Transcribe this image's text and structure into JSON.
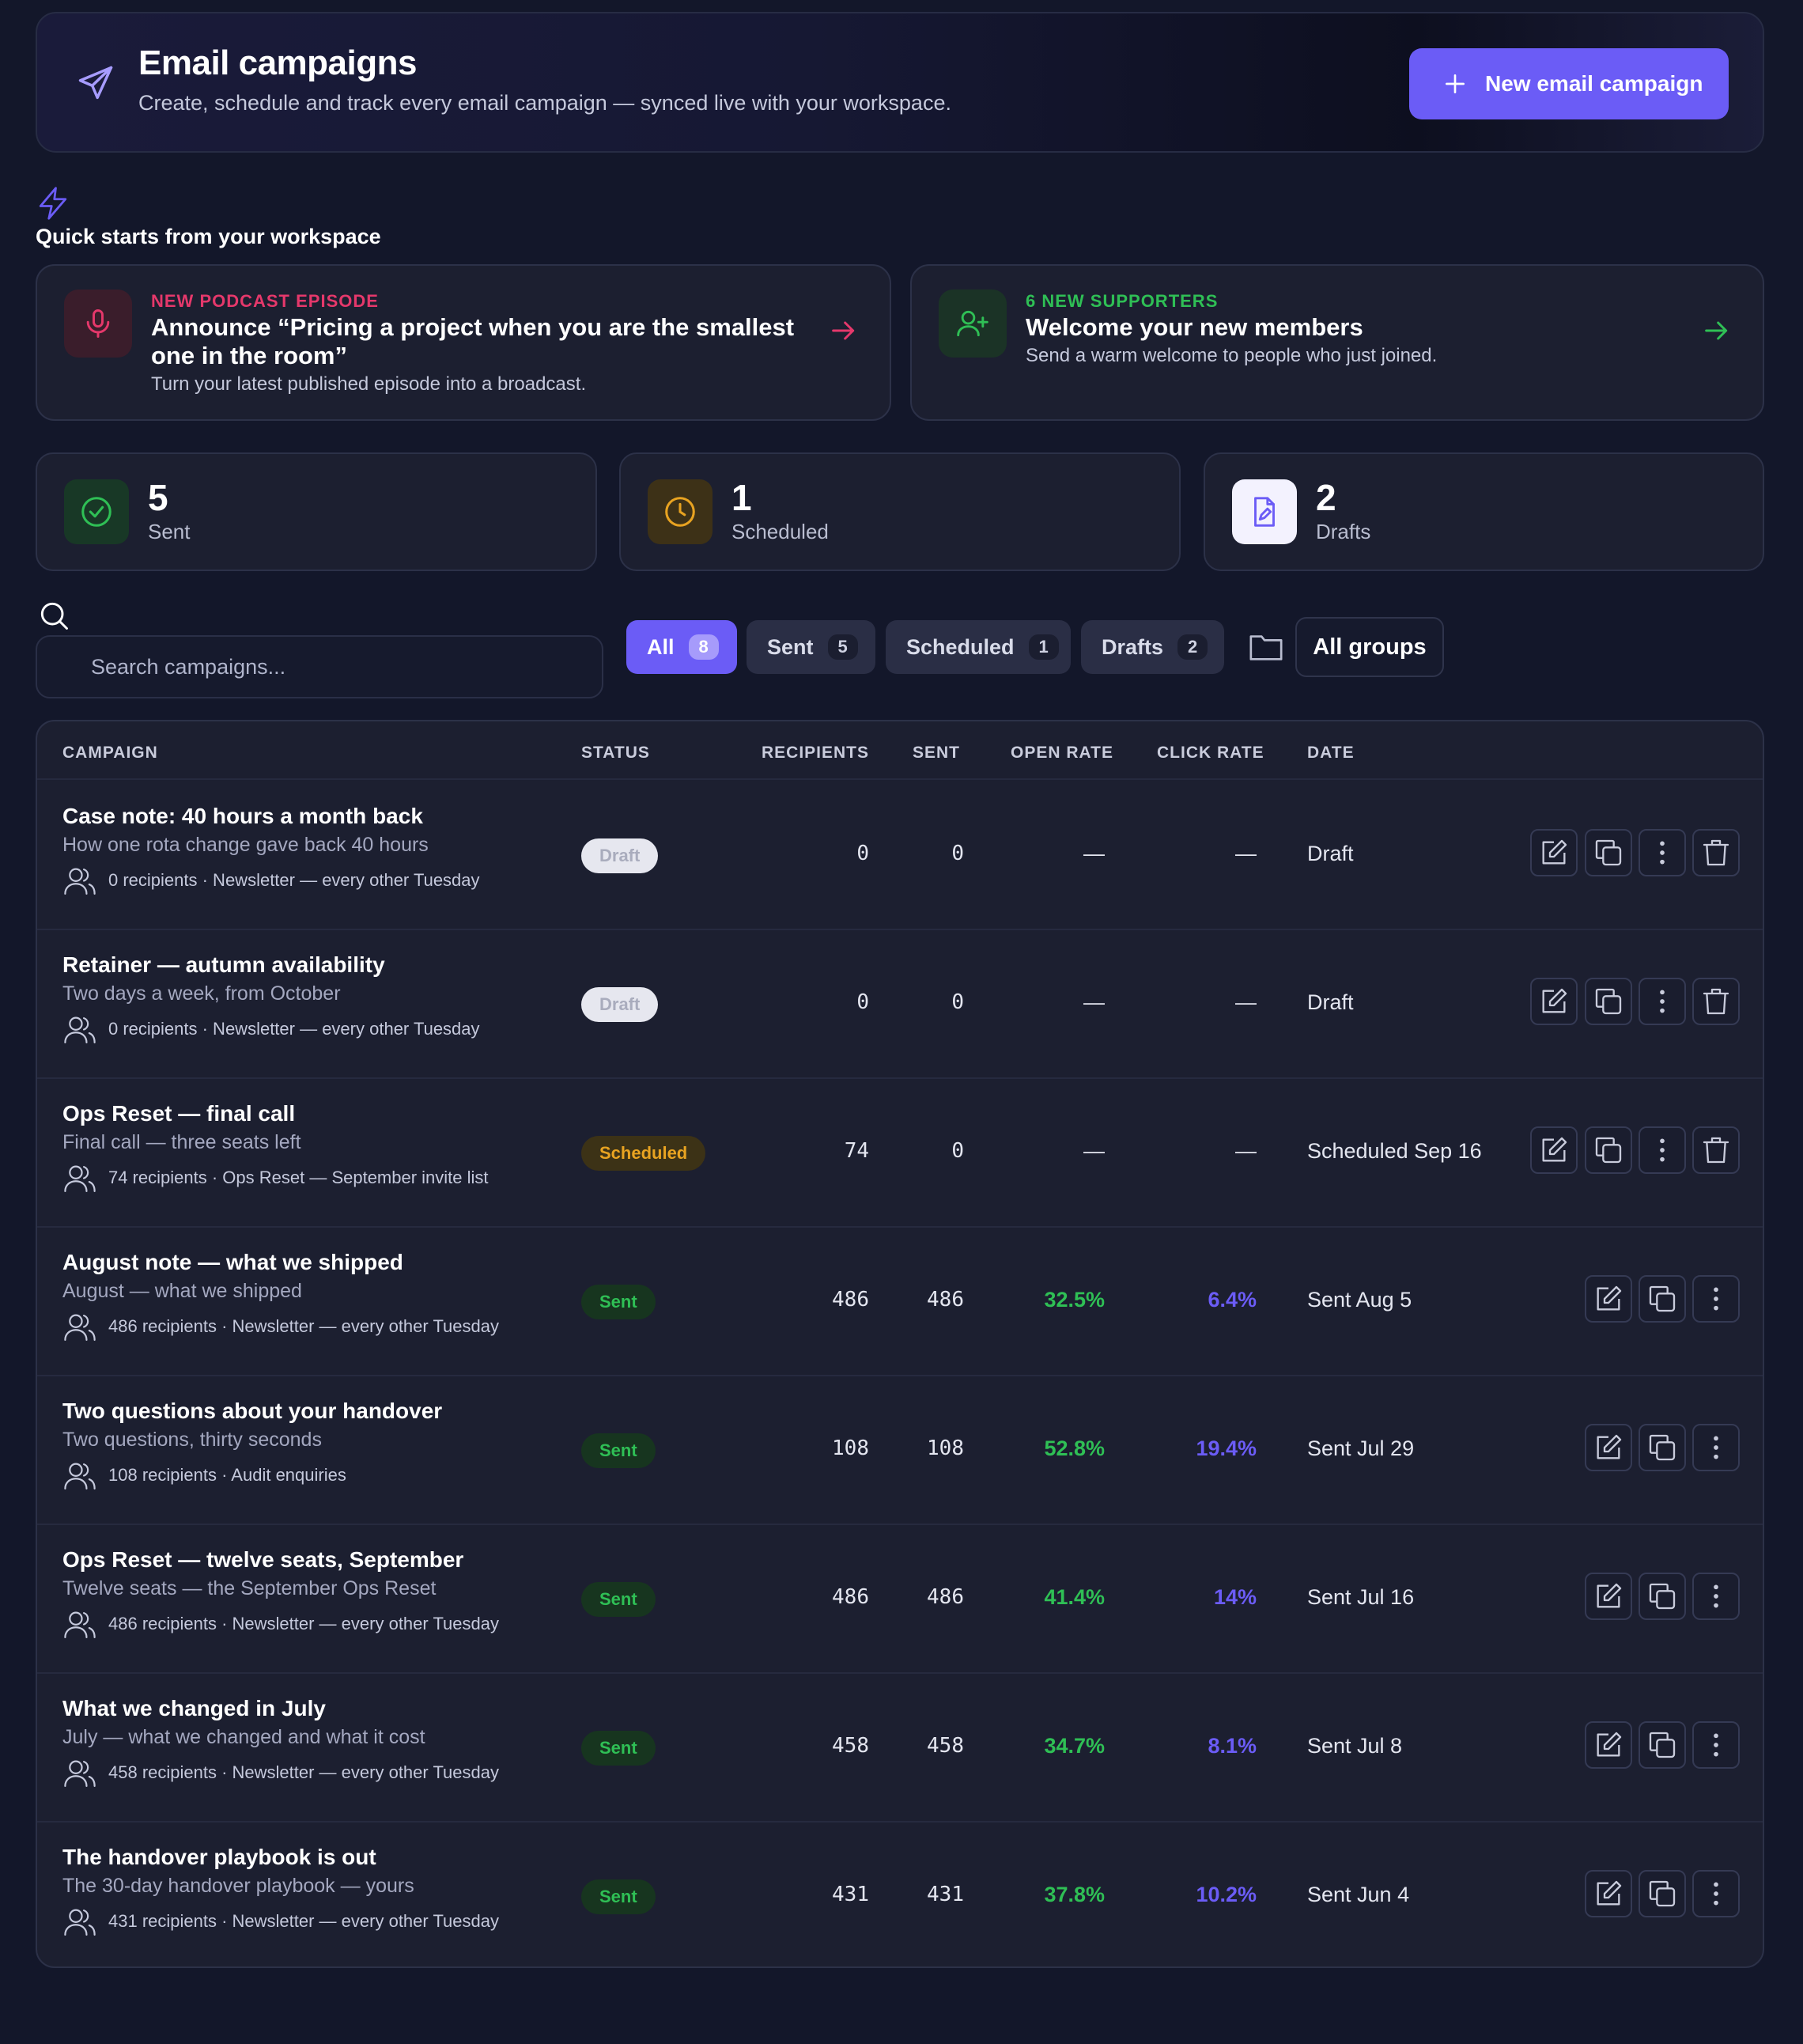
{
  "header": {
    "title": "Email campaigns",
    "subtitle": "Create, schedule and track every email campaign — synced live with your workspace.",
    "new_button": "New email campaign",
    "icon": "paper-plane-icon"
  },
  "quick_starts": {
    "title": "Quick starts from your workspace",
    "icon": "lightning-icon",
    "cards": [
      {
        "eyebrow": "NEW PODCAST EPISODE",
        "title": "Announce “Pricing a project when you are the smallest one in the room”",
        "description": "Turn your latest published episode into a broadcast.",
        "icon": "microphone-icon",
        "accent": "#e5386b"
      },
      {
        "eyebrow": "6 NEW SUPPORTERS",
        "title": "Welcome your new members",
        "description": "Send a warm welcome to people who just joined.",
        "icon": "user-plus-icon",
        "accent": "#2fbf55"
      }
    ]
  },
  "stats": [
    {
      "value": "5",
      "label": "Sent",
      "icon": "check-circle-icon",
      "color": "#2fbf55"
    },
    {
      "value": "1",
      "label": "Scheduled",
      "icon": "clock-icon",
      "color": "#e8a321"
    },
    {
      "value": "2",
      "label": "Drafts",
      "icon": "file-edit-icon",
      "color": "#6b5cf6"
    }
  ],
  "search": {
    "placeholder": "Search campaigns..."
  },
  "filters": [
    {
      "label": "All",
      "count": "8",
      "active": true
    },
    {
      "label": "Sent",
      "count": "5"
    },
    {
      "label": "Scheduled",
      "count": "1"
    },
    {
      "label": "Drafts",
      "count": "2"
    }
  ],
  "groups_select": "All groups",
  "table": {
    "columns": [
      "CAMPAIGN",
      "STATUS",
      "RECIPIENTS",
      "SENT",
      "OPEN RATE",
      "CLICK RATE",
      "DATE"
    ],
    "rows": [
      {
        "title": "Case note: 40 hours a month back",
        "subtitle": "How one rota change gave back 40 hours",
        "meta": "0 recipients · Newsletter — every other Tuesday",
        "status": "Draft",
        "recipients": "0",
        "sent": "0",
        "open": "—",
        "click": "—",
        "date": "Draft"
      },
      {
        "title": "Retainer — autumn availability",
        "subtitle": "Two days a week, from October",
        "meta": "0 recipients · Newsletter — every other Tuesday",
        "status": "Draft",
        "recipients": "0",
        "sent": "0",
        "open": "—",
        "click": "—",
        "date": "Draft"
      },
      {
        "title": "Ops Reset — final call",
        "subtitle": "Final call — three seats left",
        "meta": "74 recipients · Ops Reset — September invite list",
        "status": "Scheduled",
        "recipients": "74",
        "sent": "0",
        "open": "—",
        "click": "—",
        "date": "Scheduled Sep 16"
      },
      {
        "title": "August note — what we shipped",
        "subtitle": "August — what we shipped",
        "meta": "486 recipients · Newsletter — every other Tuesday",
        "status": "Sent",
        "recipients": "486",
        "sent": "486",
        "open": "32.5%",
        "click": "6.4%",
        "date": "Sent Aug 5"
      },
      {
        "title": "Two questions about your handover",
        "subtitle": "Two questions, thirty seconds",
        "meta": "108 recipients · Audit enquiries",
        "status": "Sent",
        "recipients": "108",
        "sent": "108",
        "open": "52.8%",
        "click": "19.4%",
        "date": "Sent Jul 29"
      },
      {
        "title": "Ops Reset — twelve seats, September",
        "subtitle": "Twelve seats — the September Ops Reset",
        "meta": "486 recipients · Newsletter — every other Tuesday",
        "status": "Sent",
        "recipients": "486",
        "sent": "486",
        "open": "41.4%",
        "click": "14%",
        "date": "Sent Jul 16"
      },
      {
        "title": "What we changed in July",
        "subtitle": "July — what we changed and what it cost",
        "meta": "458 recipients · Newsletter — every other Tuesday",
        "status": "Sent",
        "recipients": "458",
        "sent": "458",
        "open": "34.7%",
        "click": "8.1%",
        "date": "Sent Jul 8"
      },
      {
        "title": "The handover playbook is out",
        "subtitle": "The 30-day handover playbook — yours",
        "meta": "431 recipients · Newsletter — every other Tuesday",
        "status": "Sent",
        "recipients": "431",
        "sent": "431",
        "open": "37.8%",
        "click": "10.2%",
        "date": "Sent Jun 4"
      }
    ]
  }
}
